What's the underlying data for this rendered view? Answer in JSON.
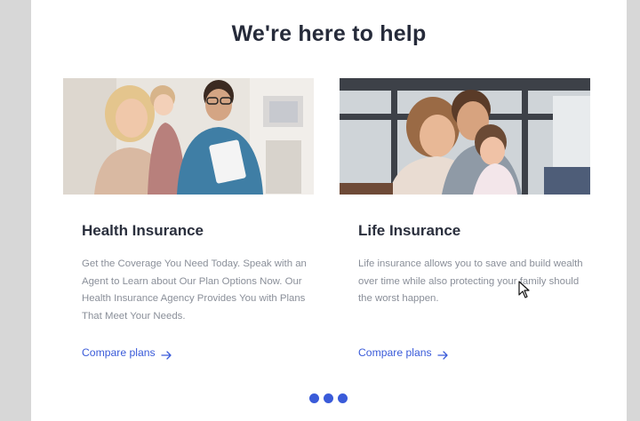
{
  "section": {
    "title": "We're here to help"
  },
  "cards": [
    {
      "title": "Health Insurance",
      "description": "Get the Coverage You Need Today. Speak with an Agent to Learn about Our Plan Options Now. Our Health Insurance Agency Provides You with Plans That Meet Your Needs.",
      "link_label": "Compare plans",
      "image_icon": "doctor-family-photo"
    },
    {
      "title": "Life Insurance",
      "description": "Life insurance allows you to save and build wealth over time while also protecting your family should the worst happen.",
      "link_label": "Compare plans",
      "image_icon": "family-hug-photo"
    }
  ],
  "carousel": {
    "dot_count": 3
  },
  "colors": {
    "accent": "#3a5bd9",
    "heading": "#262b3a",
    "body_text": "#8a8f99",
    "page_background": "#d7d7d7",
    "panel_background": "#ffffff"
  },
  "icons": {
    "link_arrow": "arrow-right-icon",
    "pointer": "mouse-cursor-icon"
  }
}
